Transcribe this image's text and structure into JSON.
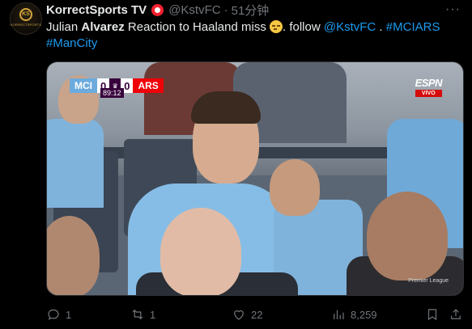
{
  "tweet": {
    "display_name": "KorrectSports TV",
    "handle": "@KstvFC",
    "separator": "·",
    "time": "51分钟",
    "text": {
      "part1": "Julian ",
      "bold": "Alvarez",
      "part2": " Reaction to Haaland miss ",
      "part3": ". follow ",
      "mention": "@KstvFC",
      "part4": " . ",
      "hashtag1": "#MCIARS",
      "hashtag2": "#ManCity"
    }
  },
  "avatar": {
    "logo_text": "KORRECTSPORTS"
  },
  "video": {
    "home_team": "MCI",
    "home_score": "0",
    "away_score": "0",
    "away_team": "ARS",
    "clock": "89:12",
    "broadcaster": "ESPN",
    "live_label": "VIVO",
    "watermark": "Premier League"
  },
  "actions": {
    "replies": "1",
    "retweets": "1",
    "likes": "22",
    "views": "8,259"
  },
  "colors": {
    "background": "#000000",
    "text": "#e7e9ea",
    "muted": "#71767b",
    "link": "#1d9bf0",
    "verified": "#f4212e"
  }
}
